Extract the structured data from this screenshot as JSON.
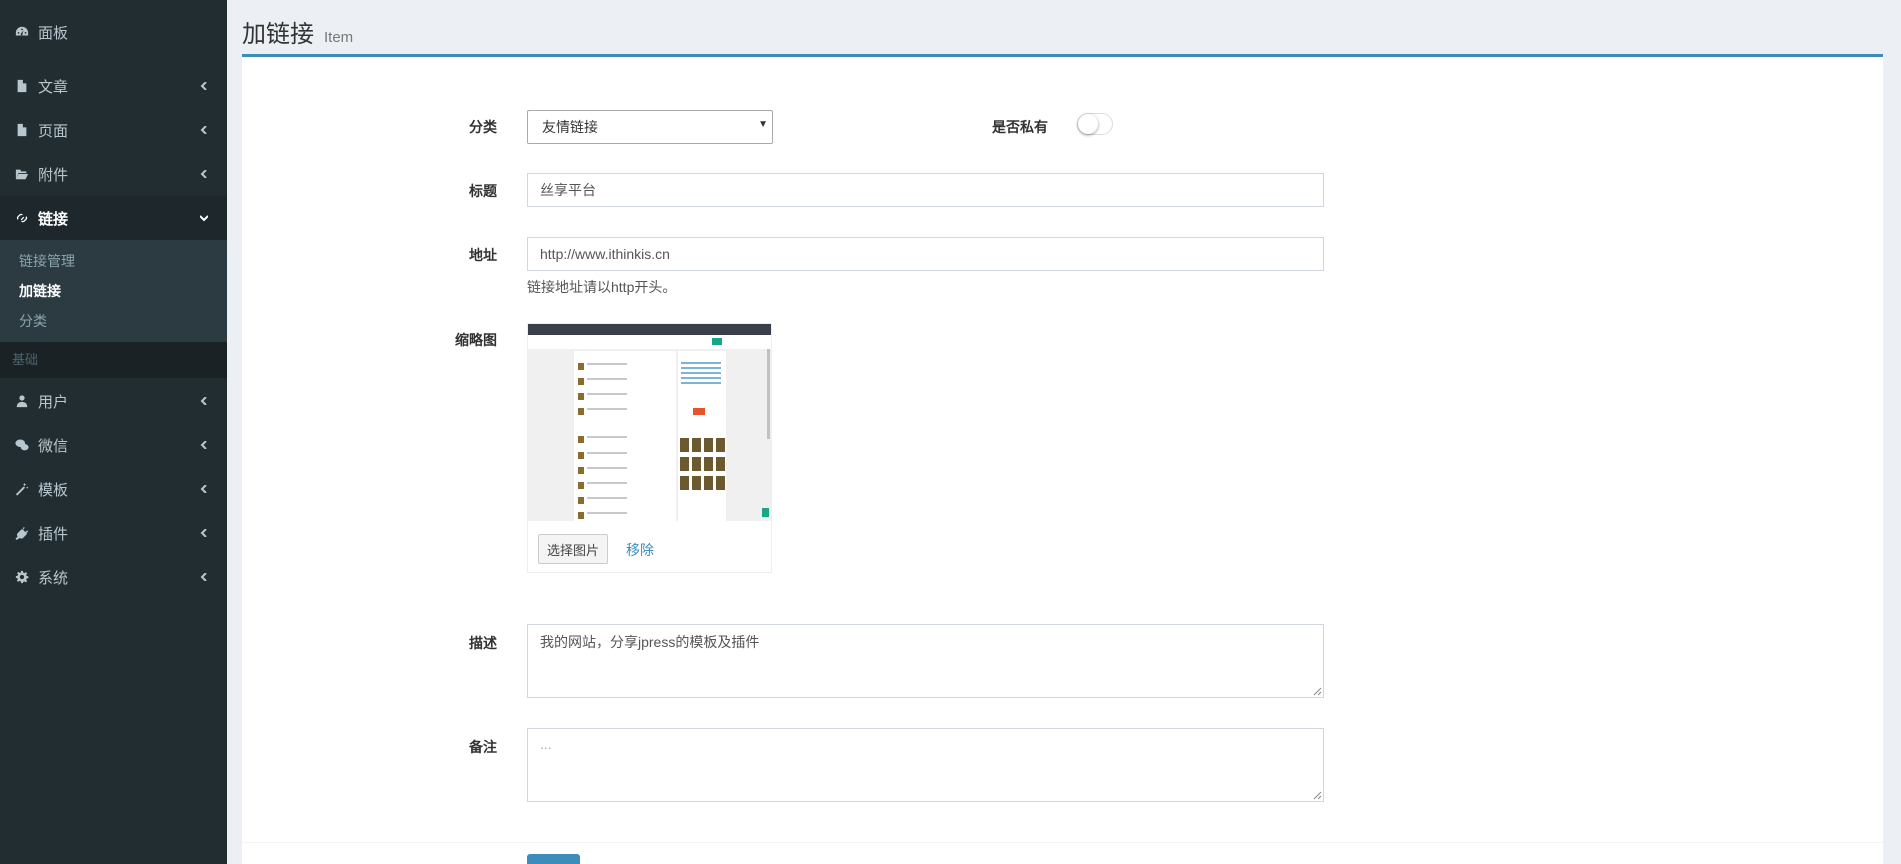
{
  "sidebar": {
    "items": [
      {
        "label": "面板",
        "icon": "dashboard-icon"
      },
      {
        "label": "文章",
        "icon": "file-icon"
      },
      {
        "label": "页面",
        "icon": "page-icon"
      },
      {
        "label": "附件",
        "icon": "folder-open-icon"
      },
      {
        "label": "链接",
        "icon": "link-icon"
      },
      {
        "label": "用户",
        "icon": "user-icon"
      },
      {
        "label": "微信",
        "icon": "wechat-icon"
      },
      {
        "label": "模板",
        "icon": "magic-wand-icon"
      },
      {
        "label": "插件",
        "icon": "plug-icon"
      },
      {
        "label": "系统",
        "icon": "gear-icon"
      }
    ],
    "submenu": [
      "链接管理",
      "加链接",
      "分类"
    ],
    "section_header": "基础"
  },
  "header": {
    "title": "加链接",
    "subtitle": "Item"
  },
  "form": {
    "category_label": "分类",
    "category_value": "友情链接",
    "private_label": "是否私有",
    "private_on": false,
    "title_label": "标题",
    "title_value": "丝享平台",
    "url_label": "地址",
    "url_value": "http://www.ithinkis.cn",
    "url_help": "链接地址请以http开头。",
    "thumb_label": "缩略图",
    "choose_image": "选择图片",
    "remove": "移除",
    "desc_label": "描述",
    "desc_value": "我的网站，分享jpress的模板及插件",
    "note_label": "备注",
    "note_placeholder": "..."
  },
  "colors": {
    "sidebar_bg": "#222d32",
    "accent": "#3c8dbc",
    "page_bg": "#ecf0f5"
  }
}
